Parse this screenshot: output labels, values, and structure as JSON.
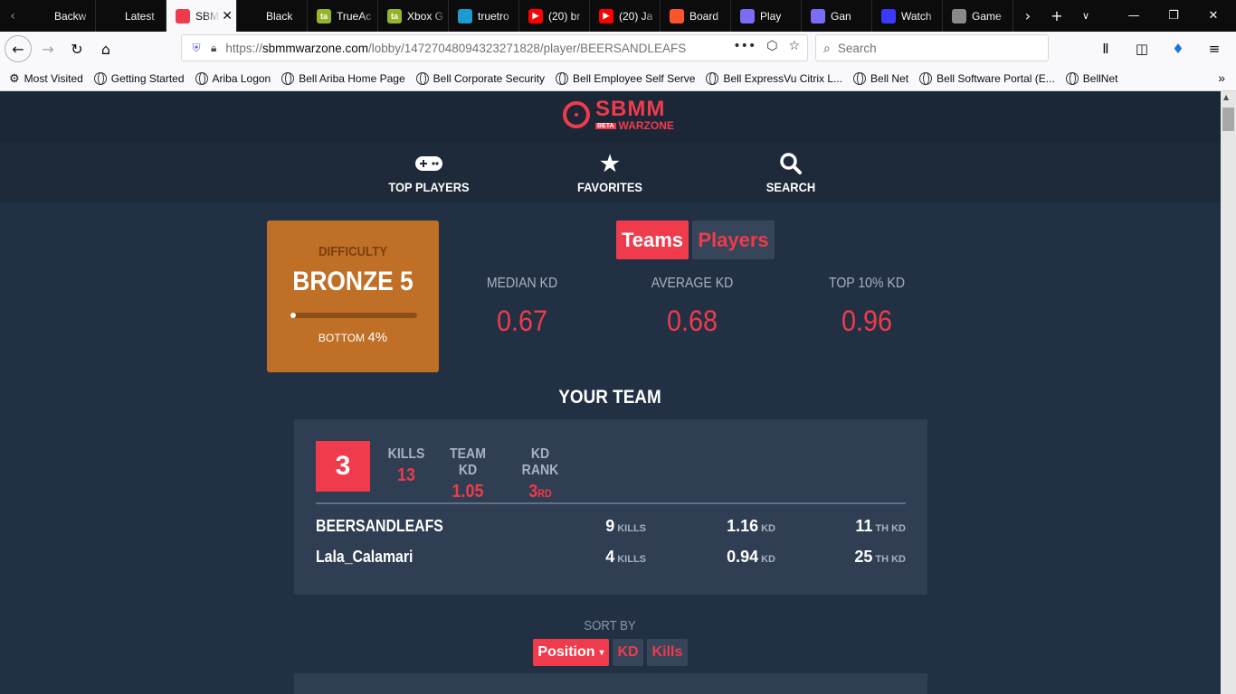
{
  "browser": {
    "tabs": [
      {
        "title": "Backw",
        "icon": "panda-icon",
        "color": "#0c0c0d"
      },
      {
        "title": "Latest",
        "icon": "panda-icon",
        "color": "#0c0c0d"
      },
      {
        "title": "SBM",
        "icon": "sbmm-icon",
        "color": "#ef3b4b",
        "active": true
      },
      {
        "title": "Black",
        "icon": "black-icon",
        "color": "#0c0c0d"
      },
      {
        "title": "TrueAc",
        "icon": "ta-icon",
        "color": "#96b32c"
      },
      {
        "title": "Xbox G",
        "icon": "ta-icon",
        "color": "#96b32c"
      },
      {
        "title": "truetro",
        "icon": "tt-icon",
        "color": "#1d9bd1"
      },
      {
        "title": "(20) br",
        "icon": "youtube-icon",
        "color": "#ff0000"
      },
      {
        "title": "(20) Ja",
        "icon": "youtube-icon",
        "color": "#ff0000"
      },
      {
        "title": "Board",
        "icon": "brave-icon",
        "color": "#fb542b"
      },
      {
        "title": "Play",
        "icon": "play-icon",
        "color": "#7b6cf6"
      },
      {
        "title": "Gan",
        "icon": "play-icon",
        "color": "#7b6cf6"
      },
      {
        "title": "Watch",
        "icon": "watch-icon",
        "color": "#3a3aff"
      },
      {
        "title": "Game",
        "icon": "game-icon",
        "color": "#8a8a8a"
      }
    ],
    "url_prefix": "https://",
    "url_domain": "sbmmwarzone.com",
    "url_path": "/lobby/1472704809432327182​8/player/BEERSANDLEAFS",
    "search_placeholder": "Search",
    "bookmarks": [
      {
        "label": "Most Visited",
        "icon": "gear-icon"
      },
      {
        "label": "Getting Started",
        "icon": "globe-icon"
      },
      {
        "label": "Ariba Logon",
        "icon": "globe-icon"
      },
      {
        "label": "Bell Ariba Home Page",
        "icon": "globe-icon"
      },
      {
        "label": "Bell Corporate Security",
        "icon": "globe-icon"
      },
      {
        "label": "Bell Employee Self Serve",
        "icon": "globe-icon"
      },
      {
        "label": "Bell ExpressVu Citrix L...",
        "icon": "globe-icon"
      },
      {
        "label": "Bell Net",
        "icon": "globe-icon"
      },
      {
        "label": "Bell Software Portal (E...",
        "icon": "globe-icon"
      },
      {
        "label": "BellNet",
        "icon": "globe-icon"
      }
    ]
  },
  "site": {
    "logo_main": "SBMM",
    "logo_beta": "BETA",
    "logo_sub": "WARZONE",
    "nav": [
      {
        "label": "TOP PLAYERS",
        "icon": "gamepad-icon"
      },
      {
        "label": "FAVORITES",
        "icon": "star-icon"
      },
      {
        "label": "SEARCH",
        "icon": "search-icon"
      }
    ],
    "difficulty": {
      "caption": "DIFFICULTY",
      "rank": "BRONZE 5",
      "bottom_label": "BOTTOM",
      "bottom_pct": "4%",
      "bar_fraction": 0.04
    },
    "toggle": {
      "teams": "Teams",
      "players": "Players"
    },
    "kd_stats": [
      {
        "label": "MEDIAN KD",
        "value": "0.67"
      },
      {
        "label": "AVERAGE KD",
        "value": "0.68"
      },
      {
        "label": "TOP 10% KD",
        "value": "0.96"
      }
    ],
    "your_team_title": "YOUR TEAM",
    "team": {
      "position": "3",
      "kills_label": "KILLS",
      "kills": "13",
      "team_kd_label": "TEAM KD",
      "team_kd": "1.05",
      "kd_rank_label": "KD RANK",
      "kd_rank": "3",
      "kd_rank_suffix": "RD",
      "players": [
        {
          "name": "BEERSANDLEAFS",
          "kills": "9",
          "kills_unit": "KILLS",
          "kd": "1.16",
          "kd_unit": "KD",
          "rank": "11",
          "rank_unit": "TH KD"
        },
        {
          "name": "Lala_Calamari",
          "kills": "4",
          "kills_unit": "KILLS",
          "kd": "0.94",
          "kd_unit": "KD",
          "rank": "25",
          "rank_unit": "TH KD"
        }
      ]
    },
    "sort": {
      "label": "SORT BY",
      "options": [
        "Position",
        "KD",
        "Kills"
      ],
      "selected": "Position"
    }
  }
}
